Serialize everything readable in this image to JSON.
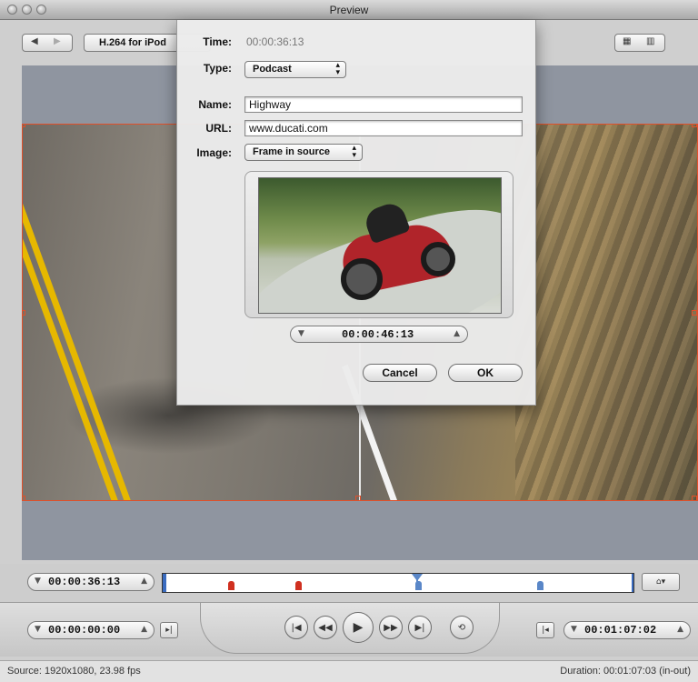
{
  "window": {
    "title": "Preview"
  },
  "toolbar": {
    "preset": "H.264 for iPod"
  },
  "timeline": {
    "current_timecode": "00:00:36:13",
    "markers": [
      {
        "type": "chapter",
        "color": "#d03020",
        "position": 0.12
      },
      {
        "type": "chapter",
        "color": "#d03020",
        "position": 0.27
      },
      {
        "type": "podcast",
        "color": "#5a87c8",
        "position": 0.54
      },
      {
        "type": "podcast",
        "color": "#5a87c8",
        "position": 0.81
      }
    ]
  },
  "transport": {
    "in_timecode": "00:00:00:00",
    "out_timecode": "00:01:07:02"
  },
  "status": {
    "source": "Source: 1920x1080, 23.98 fps",
    "duration": "Duration: 00:01:07:03 (in-out)"
  },
  "dialog": {
    "time_label": "Time:",
    "time_value": "00:00:36:13",
    "type_label": "Type:",
    "type_value": "Podcast",
    "name_label": "Name:",
    "name_value": "Highway",
    "url_label": "URL:",
    "url_value": "www.ducati.com",
    "image_label": "Image:",
    "image_value": "Frame in source",
    "frame_timecode": "00:00:46:13",
    "cancel_label": "Cancel",
    "ok_label": "OK"
  },
  "colors": {
    "crop_border": "#e0502a",
    "accent_blue": "#5a87c8"
  }
}
